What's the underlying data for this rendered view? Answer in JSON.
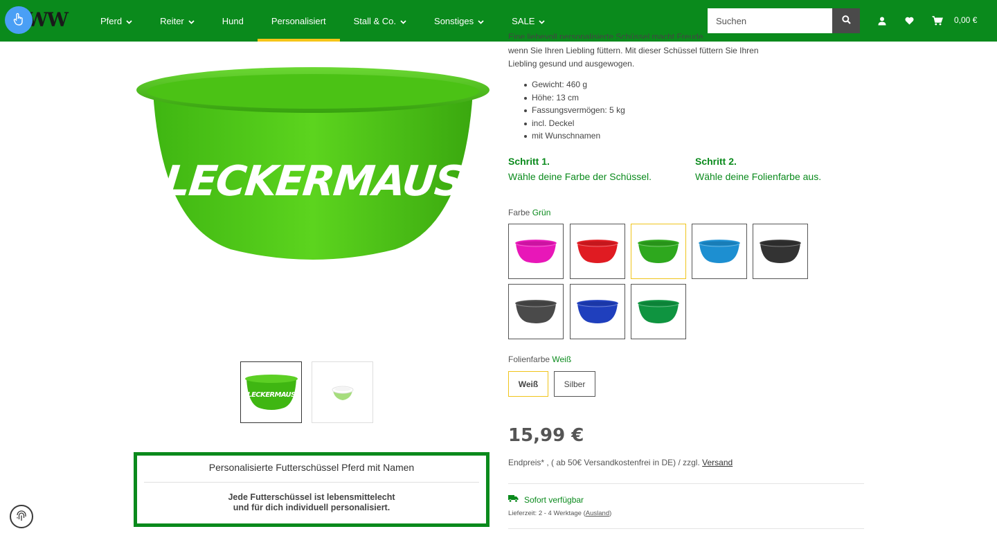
{
  "header": {
    "logo_text": "W",
    "nav": [
      {
        "label": "Pferd",
        "dropdown": true
      },
      {
        "label": "Reiter",
        "dropdown": true
      },
      {
        "label": "Hund",
        "dropdown": false
      },
      {
        "label": "Personalisiert",
        "dropdown": false,
        "active": true
      },
      {
        "label": "Stall & Co.",
        "dropdown": true
      },
      {
        "label": "Sonstiges",
        "dropdown": true
      },
      {
        "label": "SALE",
        "dropdown": true
      }
    ],
    "search_placeholder": "Suchen",
    "cart_total": "0,00 €",
    "icons": [
      "search-icon",
      "user-icon",
      "heart-icon",
      "cart-icon"
    ]
  },
  "gallery": {
    "main_image_text": "LECKERMAUS",
    "thumbnails": [
      {
        "text": "LECKERMAUS",
        "selected": true
      },
      {
        "text": "",
        "selected": false
      }
    ]
  },
  "info_box": {
    "title": "Personalisierte Futterschüssel Pferd mit Namen",
    "text": "Jede Futterschüssel ist lebensmittelecht\nund für dich individuell personalisiert."
  },
  "description": {
    "partial_line": "Eine liebevoll personalisierte Schüssel macht Freude,",
    "text": "wenn Sie Ihren Liebling füttern. Mit dieser Schüssel füttern Sie Ihren Liebling gesund und ausgewogen.",
    "bullets": [
      "Gewicht: 460 g",
      "Höhe: 13 cm",
      "Fassungsvermögen: 5 kg",
      "incl. Deckel",
      "mit Wunschnamen"
    ]
  },
  "steps": [
    {
      "title": "Schritt 1.",
      "text": "Wähle deine Farbe der Schüssel."
    },
    {
      "title": "Schritt 2.",
      "text": "Wähle deine Folienfarbe aus."
    }
  ],
  "color_option": {
    "label": "Farbe",
    "selected": "Grün",
    "swatch_colors": [
      "#e817b8",
      "#e01b22",
      "#2ea81e",
      "#1d8fd1",
      "#333333",
      "#4a4a4a",
      "#1f3fbd",
      "#0f9440"
    ],
    "selected_index": 2
  },
  "foil_option": {
    "label": "Folienfarbe",
    "selected": "Weiß",
    "options": [
      "Weiß",
      "Silber"
    ]
  },
  "price": "15,99 €",
  "tax": {
    "prefix": "Endpreis* , ( ab 50€ Versandkostenfrei in DE) / zzgl.",
    "link": "Versand"
  },
  "availability": {
    "status": "Sofort verfügbar",
    "delivery_prefix": "Lieferzeit: 2 - 4 Werktage (",
    "delivery_link": "Ausland",
    "delivery_suffix": ")"
  },
  "colors": {
    "brand_green": "#0a8a1c",
    "active_underline": "#f5c518",
    "selected_border": "#f0c419"
  }
}
